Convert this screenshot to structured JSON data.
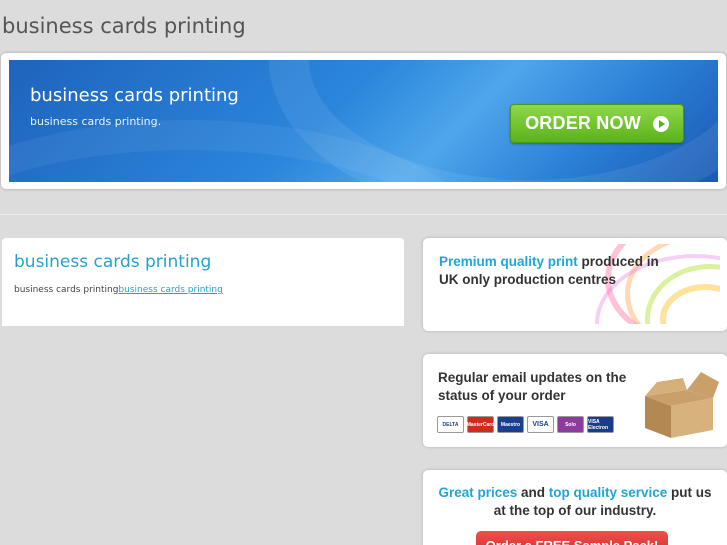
{
  "header": {
    "title": "business cards printing"
  },
  "banner": {
    "heading": "business cards printing",
    "subtext": "business cards printing.",
    "order_button": "ORDER NOW",
    "order_icon": "play-circle-icon"
  },
  "main": {
    "title": "business cards printing",
    "text": "business cards printing",
    "link": "business cards printing"
  },
  "sidebar": {
    "premium": {
      "highlight": "Premium quality print",
      "rest": " produced in UK only production centres"
    },
    "updates": {
      "text": "Regular email updates on the status of your order",
      "cards": [
        "DELTA",
        "MasterCard",
        "Maestro",
        "VISA",
        "Solo",
        "VISA Electron"
      ]
    },
    "prices": {
      "highlight1": "Great prices",
      "mid": " and ",
      "highlight2": "top quality service",
      "rest": " put us at the top of our industry.",
      "button": "Order a FREE Sample Pack!"
    }
  },
  "colors": {
    "accent": "#22a3cf",
    "order_green": "#5bb31a",
    "banner_blue": "#2b86dc",
    "cta_red": "#d9342f"
  }
}
